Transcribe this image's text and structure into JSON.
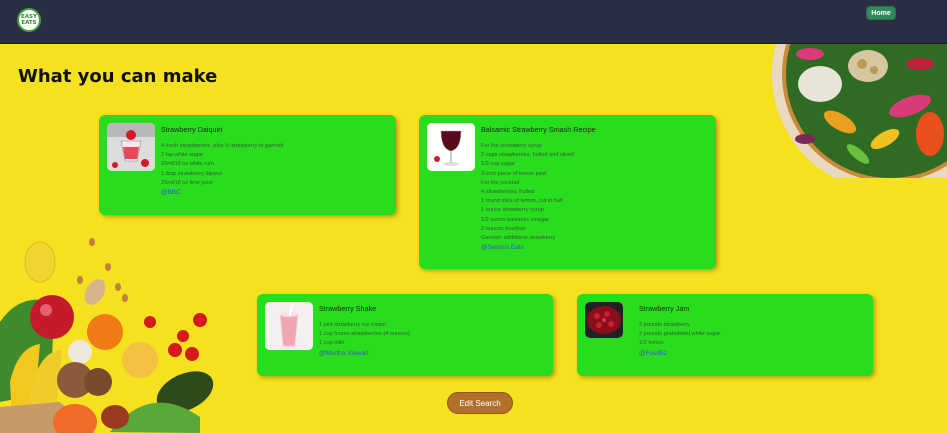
{
  "navbar": {
    "logo_line1": "EASY",
    "logo_line2": "EATS",
    "home_label": "Home"
  },
  "page": {
    "title": "What you can make"
  },
  "cards": [
    {
      "title": "Strawberry Daiquiri",
      "ingredients": [
        "4 fresh strawberries, plus ½ strawberry to garnish",
        "2 tsp white sugar",
        "25ml/1fl oz white rum",
        "1 tbsp strawberry liqueur",
        "25ml/1fl oz lime juice"
      ],
      "source": "@BBC",
      "image_icon": "cocktail-glass-image"
    },
    {
      "title": "Balsamic Strawberry Smash Recipe",
      "ingredients": [
        "For the strawberry syrup",
        "2 cups strawberries, hulled and sliced",
        "1/3 cup sugar",
        "3-inch piece of lemon peel",
        "For the cocktail",
        "4 strawberries, hulled",
        "1 round slice of lemon, cut in half",
        "1 ounce strawberry syrup",
        "1/2 ounce balsamic vinegar",
        "2 ounces bourbon",
        "Garnish: additional strawberry"
      ],
      "source": "@Serious Eats",
      "image_icon": "wine-glass-image"
    },
    {
      "title": "Strawberry Shake",
      "ingredients": [
        "1 pint strawberry ice cream",
        "1 cup frozen strawberries (4 ounces)",
        "1 cup milk"
      ],
      "source": "@Martha Stewart",
      "image_icon": "milkshake-image"
    },
    {
      "title": "Strawberry Jam",
      "ingredients": [
        "2 pounds strawberry",
        "2 pounds granulated white sugar",
        "1/2 lemon"
      ],
      "source": "@Food52",
      "image_icon": "jam-image"
    }
  ],
  "actions": {
    "edit_search_label": "Edit Search"
  },
  "colors": {
    "background": "#f5e11f",
    "navbar": "#2a2e45",
    "card": "#28dc1e",
    "home_button": "#2f8a5a",
    "edit_button": "#b3702a",
    "link": "#3c53c9"
  }
}
